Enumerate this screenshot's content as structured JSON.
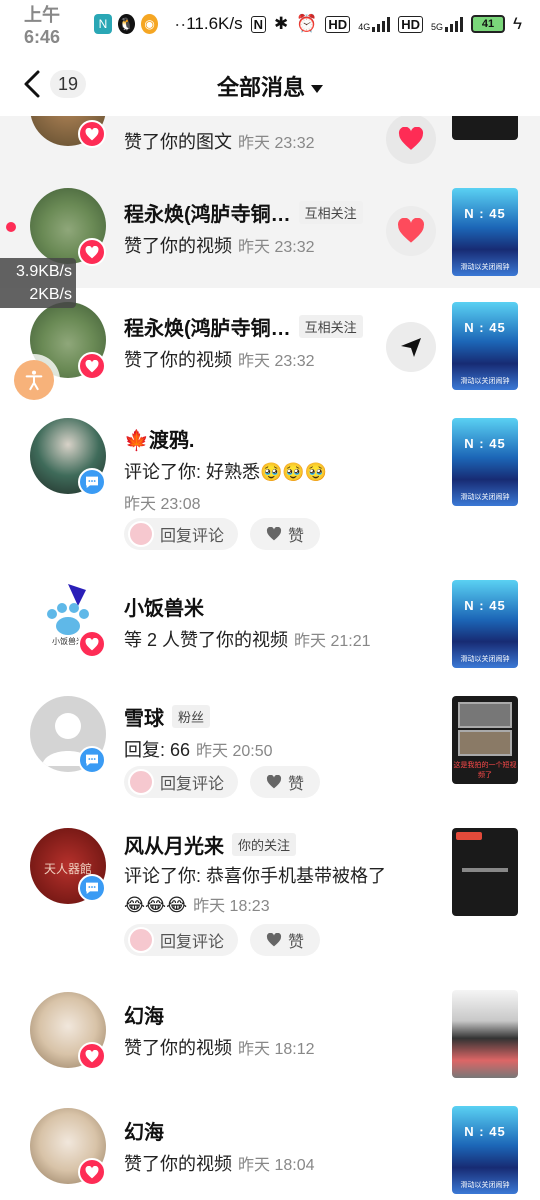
{
  "status_bar": {
    "time": "上午6:46",
    "dots": "··",
    "net_speed": "11.6K/s",
    "hd1": "HD",
    "net1": "4G",
    "hd2": "HD",
    "net2": "5G",
    "battery": "41"
  },
  "header": {
    "back_label": "‹",
    "unread_count": "19",
    "title": "全部消息"
  },
  "speed_overlay": {
    "line1": "3.9KB/s",
    "line2": "2KB/s"
  },
  "colors": {
    "like_badge": "#fe2c55",
    "comment_badge": "#3a9bf4",
    "unread_dot": "#fe2c55"
  },
  "items": [
    {
      "name": "",
      "text": "赞了你的图文",
      "time": "昨天 23:32",
      "type": "like"
    },
    {
      "name": "程永焕(鸿胪寺铜…",
      "tag": "互相关注",
      "text": "赞了你的视频",
      "time": "昨天 23:32",
      "type": "like",
      "unread": true
    },
    {
      "name": "程永焕(鸿胪寺铜…",
      "tag": "互相关注",
      "text": "赞了你的视频",
      "time": "昨天 23:32",
      "type": "like"
    },
    {
      "name": "渡鸦.",
      "name_prefix": "🍁",
      "text": "评论了你: 好熟悉🥹🥹🥹",
      "time": "昨天 23:08",
      "type": "comment",
      "reply_label": "回复评论",
      "like_label": "赞"
    },
    {
      "name": "小饭兽米",
      "text": "等 2 人赞了你的视频",
      "time": "昨天 21:21",
      "type": "like",
      "avatar_text": "小饭兽米"
    },
    {
      "name": "雪球",
      "tag": "粉丝",
      "text": "回复: 66",
      "time": "昨天 20:50",
      "type": "comment",
      "reply_label": "回复评论",
      "like_label": "赞",
      "thumb_caption": "这是我拍的一个短视频了"
    },
    {
      "name": "风从月光来",
      "tag": "你的关注",
      "text": "评论了你: 恭喜你手机基带被格了",
      "text2": "😂😂😂",
      "time": "昨天 18:23",
      "type": "comment",
      "reply_label": "回复评论",
      "like_label": "赞",
      "avatar_text": "天人器館"
    },
    {
      "name": "幻海",
      "text": "赞了你的视频",
      "time": "昨天 18:12",
      "type": "like"
    },
    {
      "name": "幻海",
      "text": "赞了你的视频",
      "time": "昨天 18:04",
      "type": "like"
    }
  ],
  "thumb_blue": {
    "title": "N : 45",
    "caption": "滑动以关闭闹钟"
  }
}
